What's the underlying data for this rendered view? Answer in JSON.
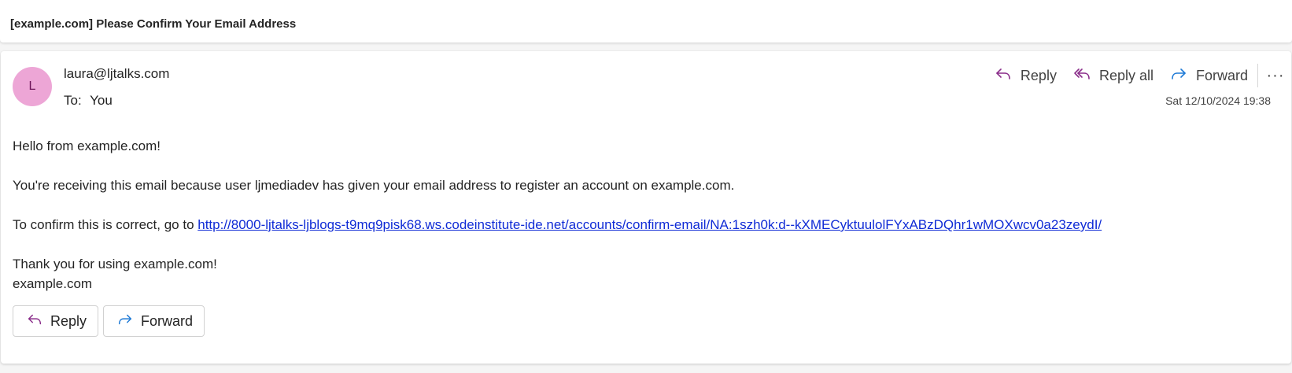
{
  "subject": "[example.com] Please Confirm Your Email Address",
  "sender": {
    "initial": "L",
    "email": "laura@ljtalks.com",
    "to_label": "To:",
    "to_value": "You",
    "avatar_color": "#eda6d6"
  },
  "header_actions": {
    "reply": "Reply",
    "reply_all": "Reply all",
    "forward": "Forward",
    "more": "···"
  },
  "timestamp": "Sat 12/10/2024 19:38",
  "body": {
    "greeting": "Hello from example.com!",
    "reason": "You're receiving this email because user ljmediadev has given your email address to register an account on example.com.",
    "confirm_prefix": "To confirm this is correct, go to ",
    "confirm_link": "http://8000-ljtalks-ljblogs-t9mq9pisk68.ws.codeinstitute-ide.net/accounts/confirm-email/NA:1szh0k:d--kXMECyktuulolFYxABzDQhr1wMOXwcv0a23zeydI/",
    "thanks": "Thank you for using example.com!",
    "signature": "example.com"
  },
  "footer_actions": {
    "reply": "Reply",
    "forward": "Forward"
  },
  "colors": {
    "reply_icon": "#8a2d8a",
    "forward_icon": "#1f7ad6",
    "link": "#0f2bd6"
  }
}
